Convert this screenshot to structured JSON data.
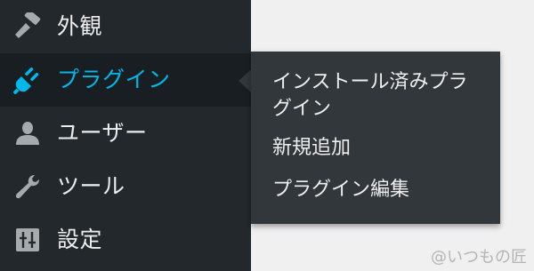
{
  "sidebar": {
    "items": [
      {
        "icon": "paintbrush-icon",
        "label": "外観",
        "active": false
      },
      {
        "icon": "plug-icon",
        "label": "プラグイン",
        "active": true
      },
      {
        "icon": "user-icon",
        "label": "ユーザー",
        "active": false
      },
      {
        "icon": "wrench-icon",
        "label": "ツール",
        "active": false
      },
      {
        "icon": "settings-sliders-icon",
        "label": "設定",
        "active": false
      }
    ]
  },
  "submenu": {
    "items": [
      {
        "label": "インストール済みプラグイン"
      },
      {
        "label": "新規追加"
      },
      {
        "label": "プラグイン編集"
      }
    ]
  },
  "watermark": "@いつもの匠",
  "colors": {
    "sidebar_bg": "#23282d",
    "active_bg": "#191e23",
    "accent": "#00b9eb",
    "submenu_bg": "#32373c",
    "text": "#eeeeee"
  }
}
